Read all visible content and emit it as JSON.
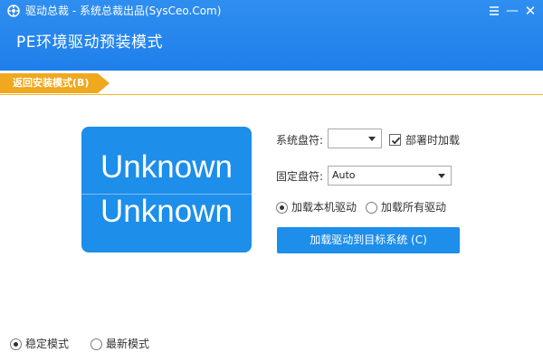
{
  "window": {
    "title": "驱动总裁 - 系统总裁出品(SysCeo.Com)",
    "menu_icon": "menu-icon",
    "minimize_icon": "minimize-icon",
    "close_icon": "close-icon",
    "minimize_glyph": "—",
    "close_glyph": "✕"
  },
  "header": {
    "mode_title": "PE环境驱动预装模式"
  },
  "tabs": {
    "return_label": "返回安装模式(B)"
  },
  "logo": {
    "line1": "Unknown",
    "line2": "Unknown"
  },
  "form": {
    "system_drive_label": "系统盘符:",
    "system_drive_value": "",
    "deploy_load_label": "部署时加载",
    "deploy_load_checked": true,
    "fixed_drive_label": "固定盘符:",
    "fixed_drive_value": "Auto",
    "load_local_label": "加载本机驱动",
    "load_all_label": "加载所有驱动",
    "load_button_label": "加载驱动到目标系统 (C)"
  },
  "footer": {
    "stable_mode_label": "稳定模式",
    "latest_mode_label": "最新模式"
  },
  "colors": {
    "header_blue": "#1f80ea",
    "tab_orange": "#f0a81e",
    "button_blue": "#1d8eea"
  }
}
